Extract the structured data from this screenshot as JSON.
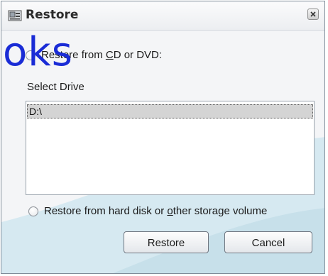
{
  "window": {
    "title": "Restore",
    "close_icon": "close-icon"
  },
  "watermark": {
    "text": "oks"
  },
  "options": {
    "cd_dvd": {
      "label_pre": "Restore from ",
      "label_underline": "C",
      "label_post": "D or DVD:"
    },
    "select_drive_label": "Select Drive",
    "drives": [
      "D:\\"
    ],
    "selected_drive": "D:\\",
    "hard_disk": {
      "label_pre": "Restore from hard disk or ",
      "label_underline": "o",
      "label_post": "ther storage volume"
    }
  },
  "buttons": {
    "restore": "Restore",
    "cancel": "Cancel"
  },
  "colors": {
    "accent_swoosh": "#cfe5ee",
    "watermark": "#1a2cd6"
  }
}
